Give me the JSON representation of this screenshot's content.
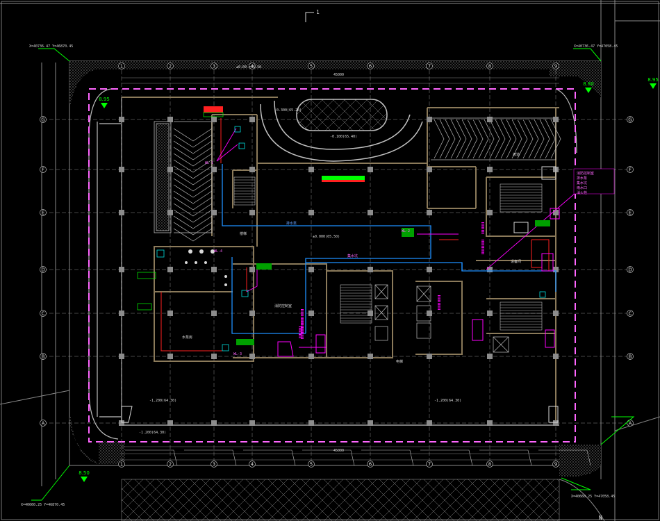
{
  "drawing": {
    "section_mark": "1",
    "north_label": "N",
    "title_note": "±0.00 =65.50",
    "colors": {
      "background": "#000000",
      "wall": "#8b7a5a",
      "grid": "#9a9a9a",
      "boundary": "#ff66ff",
      "blue_pipe": "#1e90ff",
      "red_line": "#ff2020",
      "green": "#00ff00",
      "magenta": "#ff00ff",
      "column": "#8c8c8c"
    }
  },
  "grid_columns": [
    "1",
    "2",
    "3",
    "4",
    "5",
    "6",
    "7",
    "8",
    "9"
  ],
  "grid_rows": [
    "G",
    "F",
    "E",
    "D",
    "C",
    "B",
    "A"
  ],
  "levels": {
    "top_left": "8.95",
    "top_right": "8.80",
    "far_right": "8.95",
    "bottom_left": "8.50"
  },
  "corner_notes": {
    "top_left": "X=40736.47 Y=46870.45",
    "top_right": "X=40736.47 Y=47058.45",
    "bottom_left": "X=40660.25 Y=46870.45",
    "bottom_right": "X=40660.25 Y=47058.45"
  },
  "labels": {
    "dim_top_total": "45000",
    "dim_bottom_total": "45000",
    "lobby_elev": "-0.100(65.40)",
    "dropoff_elev": "-0.300(65.20)",
    "parking_left_elev": "-1.200(64.30)",
    "parking_right_elev": "-1.200(64.30)",
    "parking_bottom_elev": "-1.200(64.30)",
    "hall_elev": "±0.000(65.50)",
    "wl_tag_1": "WL-1",
    "wl_tag_2": "WL-2",
    "wl_tag_3": "WL-3",
    "wl_tag_4": "WL-4",
    "legend_1": "消防控制室",
    "legend_2": "排水泵",
    "legend_3": "集水坑",
    "legend_4": "雨水口",
    "legend_5": "消火栓",
    "room_pump": "水泵房",
    "room_fire": "消防控制室",
    "room_elev": "电梯",
    "room_stair": "楼梯",
    "room_equip": "设备间",
    "ramp": "坡道"
  }
}
